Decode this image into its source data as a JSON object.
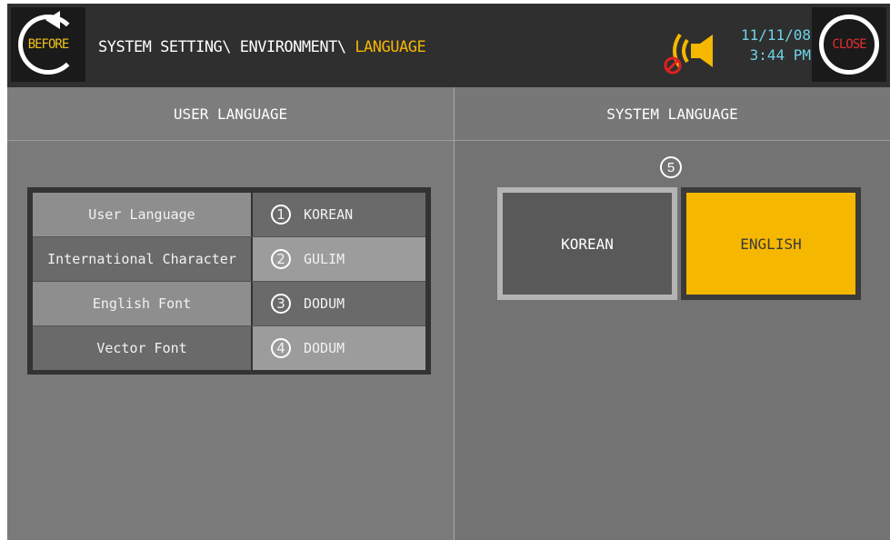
{
  "header": {
    "before_label": "BEFORE",
    "close_label": "CLOSE",
    "breadcrumb_path": "SYSTEM SETTING\\ ENVIRONMENT\\ ",
    "breadcrumb_current": "LANGUAGE",
    "date": "11/11/08",
    "time": "3:44 PM",
    "colors": {
      "accent": "#f5b700",
      "datetime": "#6fd3e6",
      "close": "#e03030"
    }
  },
  "user_language": {
    "title": "USER LANGUAGE",
    "rows": [
      {
        "label": "User Language",
        "num": "1",
        "value": "KOREAN"
      },
      {
        "label": "International Character",
        "num": "2",
        "value": "GULIM"
      },
      {
        "label": "English Font",
        "num": "3",
        "value": "DODUM"
      },
      {
        "label": "Vector Font",
        "num": "4",
        "value": "DODUM"
      }
    ]
  },
  "system_language": {
    "title": "SYSTEM LANGUAGE",
    "num": "5",
    "options": [
      {
        "label": "KOREAN",
        "selected": false
      },
      {
        "label": "ENGLISH",
        "selected": true
      }
    ]
  },
  "icons": {
    "sound": "sound-muted-icon",
    "before": "back-arrow-icon",
    "close": "close-icon"
  }
}
